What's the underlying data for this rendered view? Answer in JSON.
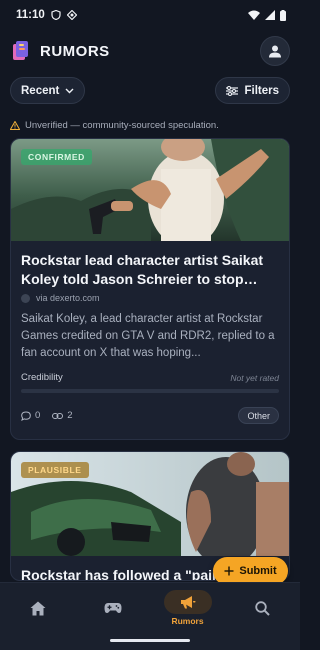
{
  "status_bar": {
    "time": "11:10"
  },
  "app": {
    "title": "RUMORS"
  },
  "filters": {
    "sort_label": "Recent",
    "filters_label": "Filters"
  },
  "notice": {
    "text": "Unverified — community-sourced speculation."
  },
  "cards": [
    {
      "badge": "CONFIRMED",
      "title": "Rockstar lead character artist Saikat Koley told Jason Schreier to stop \"poking his n...",
      "source": "via dexerto.com",
      "summary": "Saikat Koley, a lead character artist at Rockstar Games credited on GTA V and RDR2, replied to a fan account on X that was hoping...",
      "credibility_label": "Credibility",
      "credibility_value": "Not yet rated",
      "credibility_fraction": 0,
      "comments": "0",
      "links": "2",
      "tag": "Other"
    },
    {
      "badge": "PLAUSIBLE",
      "title": "Rockstar has followed a \"paintin..."
    }
  ],
  "fab": {
    "label": "Submit"
  },
  "nav": {
    "active_label": "Rumors"
  },
  "colors": {
    "accent": "#f5a524",
    "background": "#121722",
    "card": "#1b2130",
    "confirmed": "#34a86c",
    "plausible": "#a0761e"
  }
}
